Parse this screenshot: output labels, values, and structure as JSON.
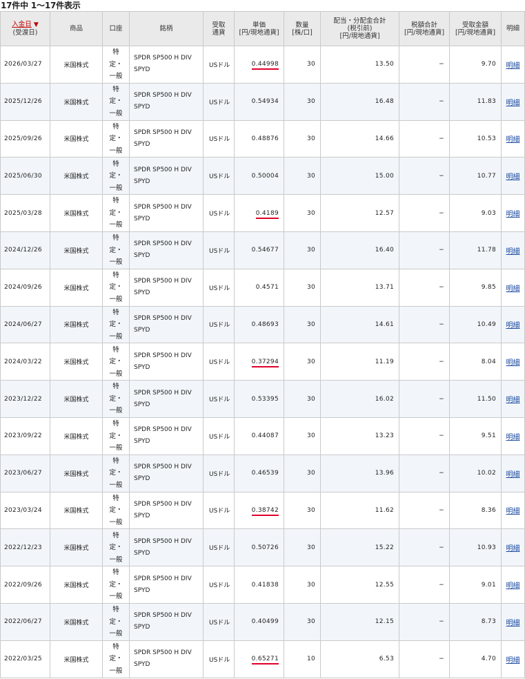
{
  "caption": "17件中 1～17件表示",
  "headers": {
    "date_main": "入金日",
    "date_arrow": "▼",
    "date_sub": "(受渡日)",
    "product": "商品",
    "account": "口座",
    "issue": "銘柄",
    "currency_1": "受取",
    "currency_2": "通貨",
    "unit_price_1": "単価",
    "unit_price_2": "[円/現地通貨]",
    "qty_1": "数量",
    "qty_2": "[株/口]",
    "dividend_1": "配当・分配金合計",
    "dividend_2": "(税引前)",
    "dividend_3": "[円/現地通貨]",
    "tax_1": "税額合計",
    "tax_2": "[円/現地通貨]",
    "received_1": "受取金額",
    "received_2": "[円/現地通貨]",
    "detail": "明細"
  },
  "rows": [
    {
      "date": "2026/03/27",
      "product": "米国株式",
      "acct_1": "特",
      "acct_2": "定・",
      "acct_3": "一般",
      "issue_1": "SPDR SP500 H DIV",
      "issue_2": "SPYD",
      "currency": "USドル",
      "unit_price": "0.44998",
      "highlight": true,
      "qty": "30",
      "dividend": "13.50",
      "tax": "−",
      "received": "9.70",
      "detail": "明細"
    },
    {
      "date": "2025/12/26",
      "product": "米国株式",
      "acct_1": "特",
      "acct_2": "定・",
      "acct_3": "一般",
      "issue_1": "SPDR SP500 H DIV",
      "issue_2": "SPYD",
      "currency": "USドル",
      "unit_price": "0.54934",
      "highlight": false,
      "qty": "30",
      "dividend": "16.48",
      "tax": "−",
      "received": "11.83",
      "detail": "明細"
    },
    {
      "date": "2025/09/26",
      "product": "米国株式",
      "acct_1": "特",
      "acct_2": "定・",
      "acct_3": "一般",
      "issue_1": "SPDR SP500 H DIV",
      "issue_2": "SPYD",
      "currency": "USドル",
      "unit_price": "0.48876",
      "highlight": false,
      "qty": "30",
      "dividend": "14.66",
      "tax": "−",
      "received": "10.53",
      "detail": "明細"
    },
    {
      "date": "2025/06/30",
      "product": "米国株式",
      "acct_1": "特",
      "acct_2": "定・",
      "acct_3": "一般",
      "issue_1": "SPDR SP500 H DIV",
      "issue_2": "SPYD",
      "currency": "USドル",
      "unit_price": "0.50004",
      "highlight": false,
      "qty": "30",
      "dividend": "15.00",
      "tax": "−",
      "received": "10.77",
      "detail": "明細"
    },
    {
      "date": "2025/03/28",
      "product": "米国株式",
      "acct_1": "特",
      "acct_2": "定・",
      "acct_3": "一般",
      "issue_1": "SPDR SP500 H DIV",
      "issue_2": "SPYD",
      "currency": "USドル",
      "unit_price": "0.4189",
      "highlight": true,
      "qty": "30",
      "dividend": "12.57",
      "tax": "−",
      "received": "9.03",
      "detail": "明細"
    },
    {
      "date": "2024/12/26",
      "product": "米国株式",
      "acct_1": "特",
      "acct_2": "定・",
      "acct_3": "一般",
      "issue_1": "SPDR SP500 H DIV",
      "issue_2": "SPYD",
      "currency": "USドル",
      "unit_price": "0.54677",
      "highlight": false,
      "qty": "30",
      "dividend": "16.40",
      "tax": "−",
      "received": "11.78",
      "detail": "明細"
    },
    {
      "date": "2024/09/26",
      "product": "米国株式",
      "acct_1": "特",
      "acct_2": "定・",
      "acct_3": "一般",
      "issue_1": "SPDR SP500 H DIV",
      "issue_2": "SPYD",
      "currency": "USドル",
      "unit_price": "0.4571",
      "highlight": false,
      "qty": "30",
      "dividend": "13.71",
      "tax": "−",
      "received": "9.85",
      "detail": "明細"
    },
    {
      "date": "2024/06/27",
      "product": "米国株式",
      "acct_1": "特",
      "acct_2": "定・",
      "acct_3": "一般",
      "issue_1": "SPDR SP500 H DIV",
      "issue_2": "SPYD",
      "currency": "USドル",
      "unit_price": "0.48693",
      "highlight": false,
      "qty": "30",
      "dividend": "14.61",
      "tax": "−",
      "received": "10.49",
      "detail": "明細"
    },
    {
      "date": "2024/03/22",
      "product": "米国株式",
      "acct_1": "特",
      "acct_2": "定・",
      "acct_3": "一般",
      "issue_1": "SPDR SP500 H DIV",
      "issue_2": "SPYD",
      "currency": "USドル",
      "unit_price": "0.37294",
      "highlight": true,
      "qty": "30",
      "dividend": "11.19",
      "tax": "−",
      "received": "8.04",
      "detail": "明細"
    },
    {
      "date": "2023/12/22",
      "product": "米国株式",
      "acct_1": "特",
      "acct_2": "定・",
      "acct_3": "一般",
      "issue_1": "SPDR SP500 H DIV",
      "issue_2": "SPYD",
      "currency": "USドル",
      "unit_price": "0.53395",
      "highlight": false,
      "qty": "30",
      "dividend": "16.02",
      "tax": "−",
      "received": "11.50",
      "detail": "明細"
    },
    {
      "date": "2023/09/22",
      "product": "米国株式",
      "acct_1": "特",
      "acct_2": "定・",
      "acct_3": "一般",
      "issue_1": "SPDR SP500 H DIV",
      "issue_2": "SPYD",
      "currency": "USドル",
      "unit_price": "0.44087",
      "highlight": false,
      "qty": "30",
      "dividend": "13.23",
      "tax": "−",
      "received": "9.51",
      "detail": "明細"
    },
    {
      "date": "2023/06/27",
      "product": "米国株式",
      "acct_1": "特",
      "acct_2": "定・",
      "acct_3": "一般",
      "issue_1": "SPDR SP500 H DIV",
      "issue_2": "SPYD",
      "currency": "USドル",
      "unit_price": "0.46539",
      "highlight": false,
      "qty": "30",
      "dividend": "13.96",
      "tax": "−",
      "received": "10.02",
      "detail": "明細"
    },
    {
      "date": "2023/03/24",
      "product": "米国株式",
      "acct_1": "特",
      "acct_2": "定・",
      "acct_3": "一般",
      "issue_1": "SPDR SP500 H DIV",
      "issue_2": "SPYD",
      "currency": "USドル",
      "unit_price": "0.38742",
      "highlight": true,
      "qty": "30",
      "dividend": "11.62",
      "tax": "−",
      "received": "8.36",
      "detail": "明細"
    },
    {
      "date": "2022/12/23",
      "product": "米国株式",
      "acct_1": "特",
      "acct_2": "定・",
      "acct_3": "一般",
      "issue_1": "SPDR SP500 H DIV",
      "issue_2": "SPYD",
      "currency": "USドル",
      "unit_price": "0.50726",
      "highlight": false,
      "qty": "30",
      "dividend": "15.22",
      "tax": "−",
      "received": "10.93",
      "detail": "明細"
    },
    {
      "date": "2022/09/26",
      "product": "米国株式",
      "acct_1": "特",
      "acct_2": "定・",
      "acct_3": "一般",
      "issue_1": "SPDR SP500 H DIV",
      "issue_2": "SPYD",
      "currency": "USドル",
      "unit_price": "0.41838",
      "highlight": false,
      "qty": "30",
      "dividend": "12.55",
      "tax": "−",
      "received": "9.01",
      "detail": "明細"
    },
    {
      "date": "2022/06/27",
      "product": "米国株式",
      "acct_1": "特",
      "acct_2": "定・",
      "acct_3": "一般",
      "issue_1": "SPDR SP500 H DIV",
      "issue_2": "SPYD",
      "currency": "USドル",
      "unit_price": "0.40499",
      "highlight": false,
      "qty": "30",
      "dividend": "12.15",
      "tax": "−",
      "received": "8.73",
      "detail": "明細"
    },
    {
      "date": "2022/03/25",
      "product": "米国株式",
      "acct_1": "特",
      "acct_2": "定・",
      "acct_3": "一般",
      "issue_1": "SPDR SP500 H DIV",
      "issue_2": "SPYD",
      "currency": "USドル",
      "unit_price": "0.65271",
      "highlight": true,
      "qty": "10",
      "dividend": "6.53",
      "tax": "−",
      "received": "4.70",
      "detail": "明細"
    }
  ],
  "colors": {
    "highlight_underline": "#e0002a",
    "link": "#1a4aa0",
    "sort_link": "#c00000",
    "header_bg": "#eaeaea",
    "stripe_bg": "#f2f6fa"
  }
}
